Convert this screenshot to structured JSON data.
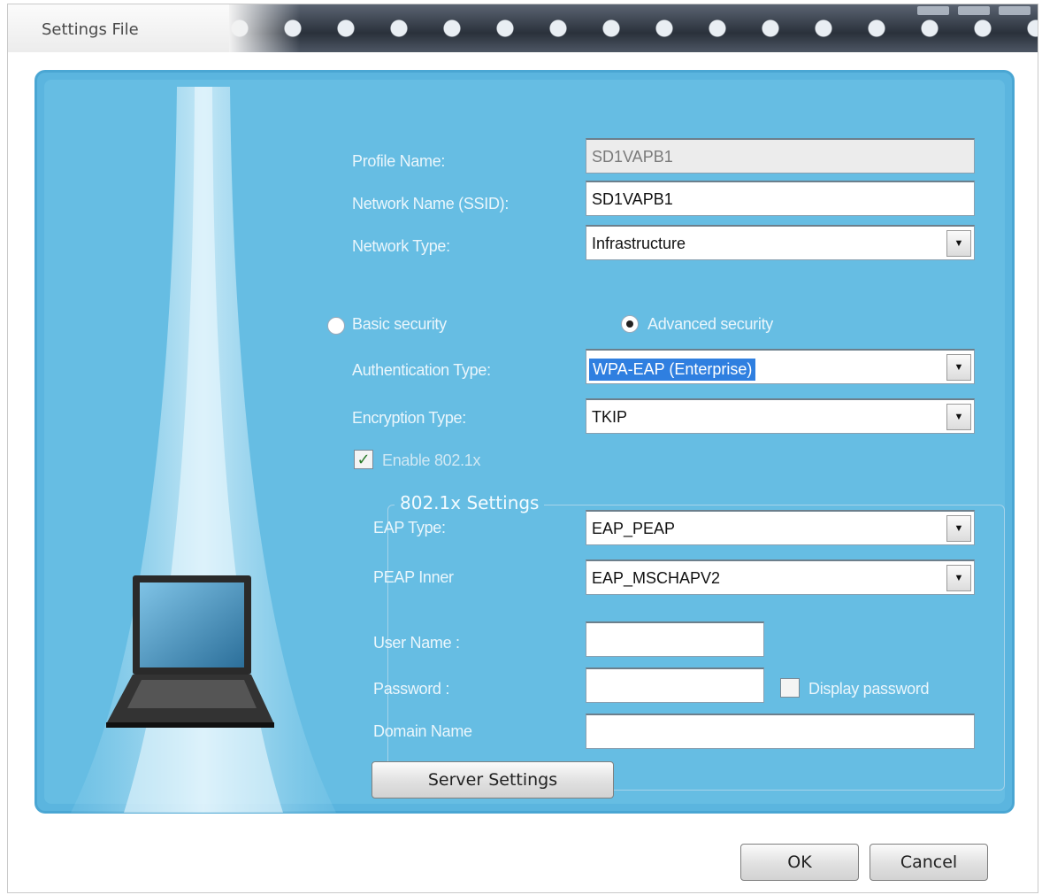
{
  "window": {
    "title": "Settings File"
  },
  "profile": {
    "profile_name_label": "Profile Name:",
    "profile_name_value": "SD1VAPB1",
    "ssid_label": "Network Name (SSID):",
    "ssid_value": "SD1VAPB1",
    "network_type_label": "Network Type:",
    "network_type_value": "Infrastructure"
  },
  "security": {
    "basic_label": "Basic security",
    "advanced_label": "Advanced security",
    "selected": "advanced",
    "auth_type_label": "Authentication Type:",
    "auth_type_value": "WPA-EAP (Enterprise)",
    "encryption_type_label": "Encryption Type:",
    "encryption_type_value": "TKIP",
    "enable_8021x_label": "Enable 802.1x",
    "enable_8021x_checked": true
  },
  "settings_8021x": {
    "group_title": "802.1x Settings",
    "eap_type_label": "EAP Type:",
    "eap_type_value": "EAP_PEAP",
    "peap_inner_label": "PEAP Inner",
    "peap_inner_value": "EAP_MSCHAPV2",
    "username_label": "User Name :",
    "username_value": "",
    "password_label": "Password :",
    "password_value": "",
    "display_password_label": "Display password",
    "display_password_checked": false,
    "domain_label": "Domain Name",
    "domain_value": "",
    "server_settings_label": "Server Settings"
  },
  "footer": {
    "ok_label": "OK",
    "cancel_label": "Cancel"
  },
  "colors": {
    "panel": "#66bde3",
    "selection": "#2f7fe0"
  }
}
